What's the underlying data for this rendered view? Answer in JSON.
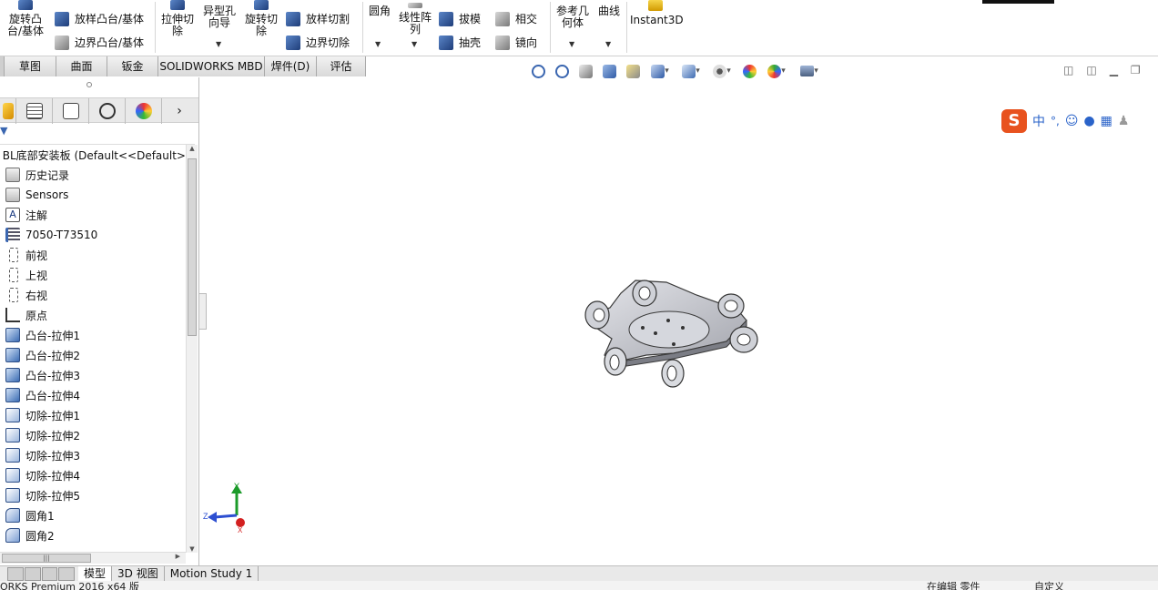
{
  "ribbon": {
    "revolve_boss": "旋转凸\n台/基体",
    "loft_boss": "放样凸台/基体",
    "boundary_boss": "边界凸台/基体",
    "extruded_cut": "拉伸切\n除",
    "hole_wizard": "异型孔\n向导",
    "revolve_cut": "旋转切\n除",
    "loft_cut": "放样切割",
    "boundary_cut": "边界切除",
    "fillet": "圆角",
    "linear_pattern": "线性阵\n列",
    "draft": "拔模",
    "shell": "抽壳",
    "intersect": "相交",
    "mirror": "镜向",
    "ref_geometry": "参考几\n何体",
    "curves": "曲线",
    "instant3d": "Instant3D"
  },
  "command_tabs": [
    "草图",
    "曲面",
    "钣金",
    "SOLIDWORKS MBD",
    "焊件(D)",
    "评估"
  ],
  "tree": {
    "root": "BL底部安装板 (Default<<Default>",
    "items": [
      {
        "label": "历史记录",
        "icon": "history-folder-icon"
      },
      {
        "label": "Sensors",
        "icon": "sensors-folder-icon"
      },
      {
        "label": "注解",
        "icon": "annotations-icon"
      },
      {
        "label": "7050-T73510",
        "icon": "material-icon"
      },
      {
        "label": "前视",
        "icon": "plane-icon"
      },
      {
        "label": "上视",
        "icon": "plane-icon"
      },
      {
        "label": "右视",
        "icon": "plane-icon"
      },
      {
        "label": "原点",
        "icon": "origin-icon"
      },
      {
        "label": "凸台-拉伸1",
        "icon": "boss-extrude-icon"
      },
      {
        "label": "凸台-拉伸2",
        "icon": "boss-extrude-icon"
      },
      {
        "label": "凸台-拉伸3",
        "icon": "boss-extrude-icon"
      },
      {
        "label": "凸台-拉伸4",
        "icon": "boss-extrude-icon"
      },
      {
        "label": "切除-拉伸1",
        "icon": "cut-extrude-icon"
      },
      {
        "label": "切除-拉伸2",
        "icon": "cut-extrude-icon"
      },
      {
        "label": "切除-拉伸3",
        "icon": "cut-extrude-icon"
      },
      {
        "label": "切除-拉伸4",
        "icon": "cut-extrude-icon"
      },
      {
        "label": "切除-拉伸5",
        "icon": "cut-extrude-icon"
      },
      {
        "label": "圆角1",
        "icon": "fillet-icon"
      },
      {
        "label": "圆角2",
        "icon": "fillet-icon"
      }
    ]
  },
  "bottom_tabs": [
    "模型",
    "3D 视图",
    "Motion Study 1"
  ],
  "status": {
    "left": "ORKS Premium 2016 x64 版",
    "mid": "在编辑 零件",
    "right": "自定义"
  },
  "triad": {
    "y": "Y",
    "z": "Z",
    "x": "X"
  },
  "ime": {
    "lang": "中",
    "punct": "°,"
  },
  "colors": {
    "accent": "#3a66b0",
    "tab_bg": "#dcdcdc",
    "ime_logo": "#e8521e"
  }
}
